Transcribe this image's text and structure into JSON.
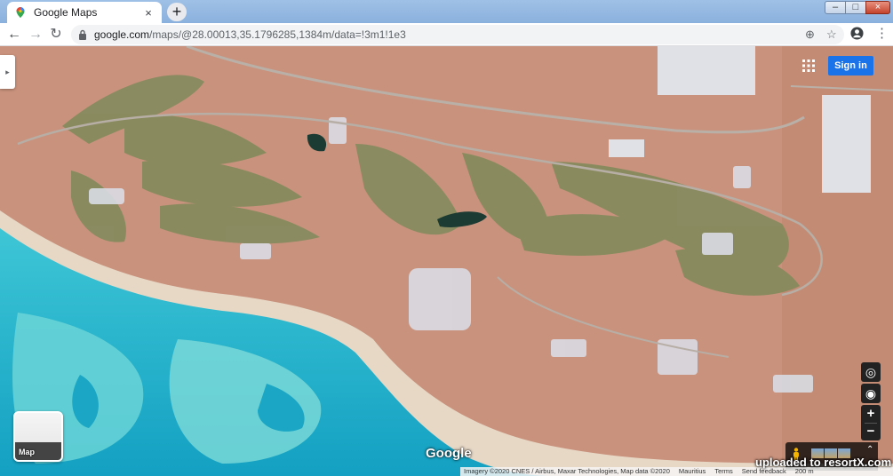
{
  "browser": {
    "tab": {
      "title": "Google Maps",
      "close_glyph": "×"
    },
    "new_tab_glyph": "+",
    "window_controls": {
      "minimize": "–",
      "maximize": "□",
      "close": "×"
    },
    "nav": {
      "back": "←",
      "forward": "→",
      "reload": "↻"
    },
    "address": {
      "host": "google.com",
      "path": "/maps/@28.00013,35.1796285,1384m/data=!3m1!1e3"
    },
    "icons": {
      "zoom": "⊕",
      "star": "☆",
      "menu": "⋮"
    }
  },
  "map": {
    "sign_in_label": "Sign in",
    "side_toggle_glyph": "▸",
    "controls": {
      "globe": "◎",
      "locate": "◉",
      "zoom_in": "+",
      "zoom_out": "−"
    },
    "map_type_label": "Map",
    "logo_text": "Google",
    "expand_glyph": "⌃",
    "footer": {
      "imagery": "Imagery ©2020 CNES / Airbus, Maxar Technologies, Map data ©2020",
      "country": "Mauritius",
      "terms": "Terms",
      "feedback": "Send feedback",
      "scale": "200 m"
    },
    "watermark": "uploaded to resortX.com",
    "colors": {
      "sand": "#c9927d",
      "sea_deep": "#1aa6c4",
      "sea_shallow": "#5fd0d8",
      "golf": "#7f8a5a",
      "signin": "#1a73e8"
    }
  }
}
